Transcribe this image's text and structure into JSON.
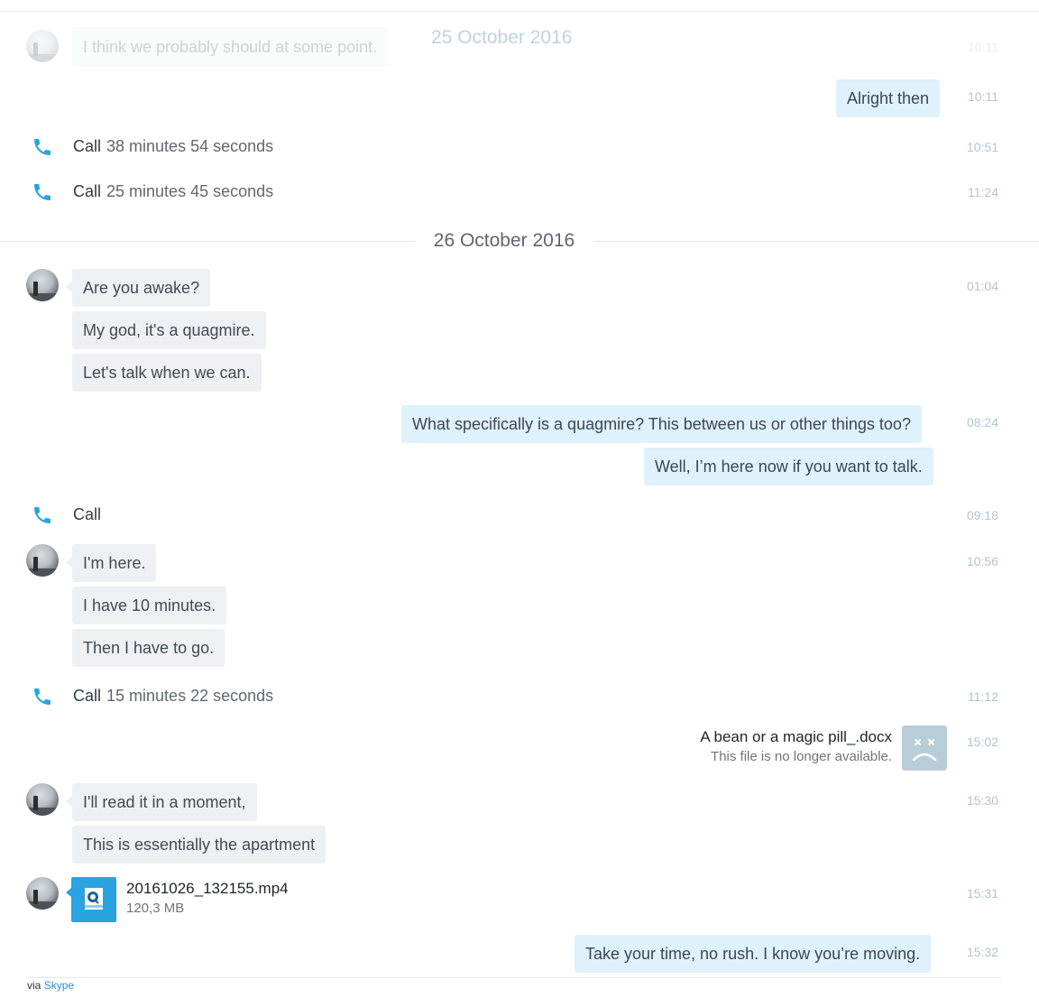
{
  "top_faded": {
    "message": "I think we probably should at some point.",
    "date": "25 October 2016",
    "time": "10:11"
  },
  "messages_before": {
    "alright": {
      "text": "Alright then",
      "time": "10:11"
    },
    "call1": {
      "label": "Call",
      "duration": "38 minutes 54 seconds",
      "time": "10:51"
    },
    "call2": {
      "label": "Call",
      "duration": "25 minutes 45 seconds",
      "time": "11:24"
    }
  },
  "date_separator": "26 October 2016",
  "group1": {
    "time": "01:04",
    "messages": [
      "Are you awake?",
      "My god, it's a quagmire.",
      "Let's talk when we can."
    ]
  },
  "group2": {
    "time": "08:24",
    "messages": [
      "What specifically is a quagmire? This between us or other things too?",
      "Well, I’m here now if you want to talk."
    ]
  },
  "call3": {
    "label": "Call",
    "time": "09:18"
  },
  "group3": {
    "time": "10:56",
    "messages": [
      "I'm here.",
      "I have 10 minutes.",
      "Then I have to go."
    ]
  },
  "call4": {
    "label": "Call",
    "duration": "15 minutes 22 seconds",
    "time": "11:12"
  },
  "file_out": {
    "name": "A bean or a magic pill_.docx",
    "status": "This file is no longer available.",
    "time": "15:02"
  },
  "group4": {
    "time": "15:30",
    "messages": [
      "I'll  read it in a moment,",
      "This is essentially the apartment"
    ]
  },
  "file_in": {
    "name": "20161026_132155.mp4",
    "size": "120,3 MB",
    "time": "15:31"
  },
  "last_out": {
    "text": "Take your time, no rush. I know you’re moving.",
    "time": "15:32"
  },
  "footer": {
    "prefix": "via",
    "link": "Skype"
  },
  "colors": {
    "accent": "#2aa3e0",
    "bubble_in": "#eef0f3",
    "bubble_out": "#dff1fa",
    "timestamp": "#b3c4d1"
  }
}
